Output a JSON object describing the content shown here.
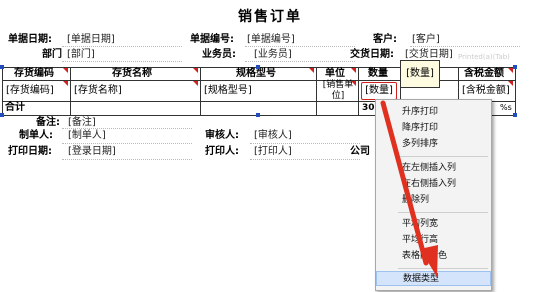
{
  "title": "销售订单",
  "header": {
    "date_label": "单据日期:",
    "date_value": "[单据日期]",
    "no_label": "单据编号:",
    "no_value": "[单据编号]",
    "cust_label": "客户:",
    "cust_value": "[客户]",
    "dept_label": "部门",
    "dept_value": "[部门]",
    "sales_label": "业务员:",
    "sales_value": "[业务员]",
    "deliv_label": "交货日期:",
    "deliv_value": "[交货日期]",
    "faint_text": "Printed(a)(Tab)"
  },
  "table": {
    "headers": [
      "存货编码",
      "存货名称",
      "规格型号",
      "单位",
      "数量",
      "",
      "含税金额"
    ],
    "row": [
      "[存货编码]",
      "[存货名称]",
      "[规格型号]",
      "[销售单位]",
      "[数量]",
      "",
      "[含税金额]"
    ],
    "total_label": "合计",
    "total_partial_1": "30",
    "total_partial_2": "%s"
  },
  "footer": {
    "remark_label": "备注:",
    "remark_value": "[备注]",
    "maker_label": "制单人:",
    "maker_value": "[制单人]",
    "auditor_label": "审核人:",
    "auditor_value": "[审核人]",
    "printdate_label": "打印日期:",
    "printdate_value": "[登录日期]",
    "printer_label": "打印人:",
    "printer_value": "[打印人]",
    "company_label": "公司"
  },
  "tooltip": "[数量]",
  "context_menu": {
    "items": [
      "升序打印",
      "降序打印",
      "多列排序",
      "在左侧插入列",
      "在右侧插入列",
      "删除列",
      "平均列宽",
      "平均行高",
      "表格间隔色",
      "数据类型"
    ],
    "highlighted_index": 9
  },
  "colors": {
    "arrow": "#e03020",
    "marker": "#d02020",
    "selection": "#1f4fbf",
    "menu_highlight": "#d4e4fb"
  }
}
